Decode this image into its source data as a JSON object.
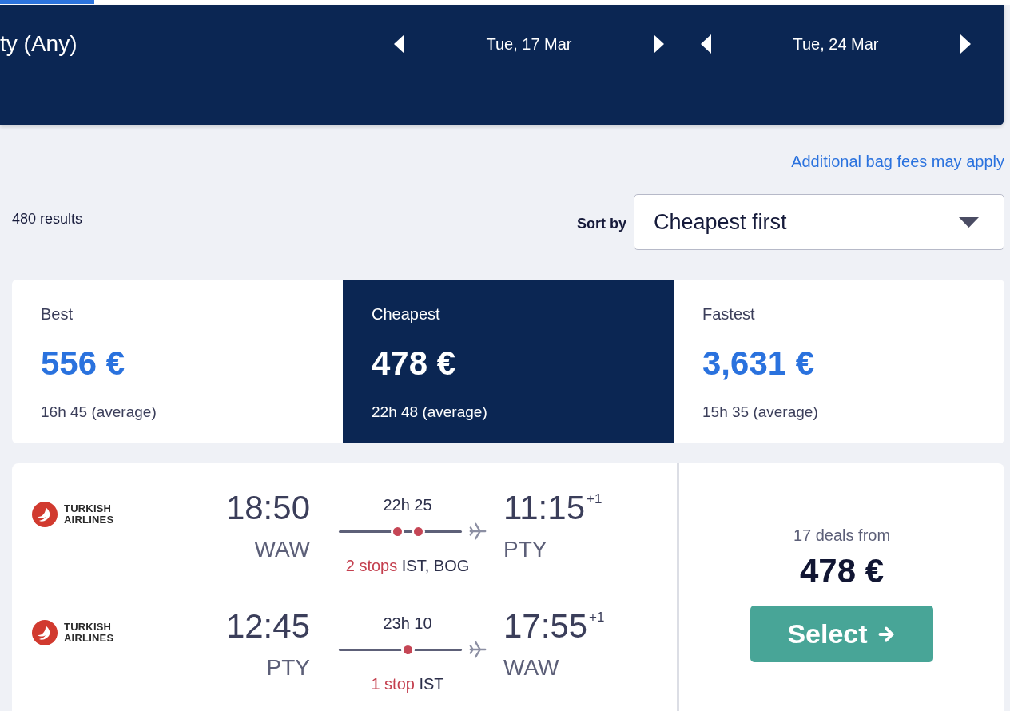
{
  "progress": {
    "level": 0.093
  },
  "header": {
    "destination": "ty (Any)",
    "dates": [
      {
        "label": "Tue, 17 Mar"
      },
      {
        "label": "Tue, 24 Mar"
      }
    ]
  },
  "bag_fees_link": "Additional bag fees may apply",
  "results_count": "480 results",
  "sort": {
    "label": "Sort by",
    "value": "Cheapest first"
  },
  "tabs": [
    {
      "label": "Best",
      "price": "556 €",
      "duration": "16h 45 (average)",
      "selected": false
    },
    {
      "label": "Cheapest",
      "price": "478 €",
      "duration": "22h 48 (average)",
      "selected": true
    },
    {
      "label": "Fastest",
      "price": "3,631 €",
      "duration": "15h 35 (average)",
      "selected": false
    }
  ],
  "results": [
    {
      "legs": [
        {
          "airline": "TURKISH AIRLINES",
          "depart_time": "18:50",
          "depart_airport": "WAW",
          "duration": "22h 25",
          "stops": [
            {
              "kind": "stop"
            },
            {
              "kind": "stop"
            }
          ],
          "stops_label": "2 stops",
          "stop_airports": "IST, BOG",
          "arrive_time": "11:15",
          "day_offset": "+1",
          "arrive_airport": "PTY"
        },
        {
          "airline": "TURKISH AIRLINES",
          "depart_time": "12:45",
          "depart_airport": "PTY",
          "duration": "23h 10",
          "stops": [
            {
              "kind": "stop"
            }
          ],
          "stops_label": "1 stop",
          "stop_airports": "IST",
          "arrive_time": "17:55",
          "day_offset": "+1",
          "arrive_airport": "WAW"
        }
      ],
      "deals": "17 deals from",
      "price": "478 €",
      "button": "Select"
    }
  ]
}
